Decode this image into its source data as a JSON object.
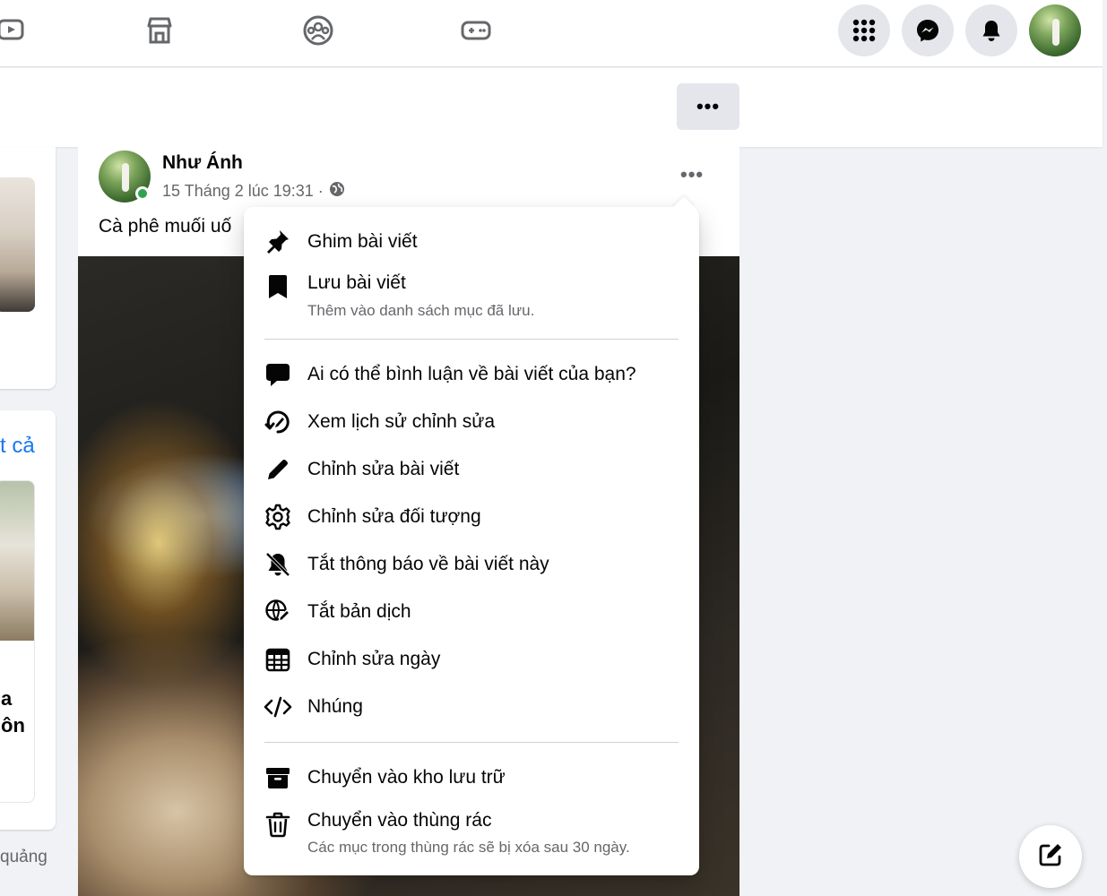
{
  "topbar": {
    "nav_icons": [
      "watch-icon",
      "marketplace-icon",
      "groups-icon",
      "gaming-icon"
    ],
    "right_buttons": [
      "menu-grid-icon",
      "messenger-icon",
      "notifications-icon"
    ]
  },
  "subbar": {
    "more_label": "•••"
  },
  "left_column": {
    "see_all": "t cả",
    "card_title_line1": "a",
    "card_title_line2": "ôn",
    "ad_label": "quảng"
  },
  "post": {
    "author": "Như Ánh",
    "timestamp": "15 Tháng 2 lúc 19:31 ·",
    "caption": "Cà phê muối uố",
    "more_label": "•••"
  },
  "menu": {
    "items": [
      {
        "icon": "pin-icon",
        "label": "Ghim bài viết"
      },
      {
        "icon": "bookmark-icon",
        "label": "Lưu bài viết",
        "sublabel": "Thêm vào danh sách mục đã lưu."
      },
      {
        "icon": "comment-icon",
        "label": "Ai có thể bình luận về bài viết của bạn?"
      },
      {
        "icon": "edit-history-icon",
        "label": "Xem lịch sử chỉnh sửa"
      },
      {
        "icon": "pencil-icon",
        "label": "Chỉnh sửa bài viết"
      },
      {
        "icon": "gear-icon",
        "label": "Chỉnh sửa đối tượng"
      },
      {
        "icon": "bell-off-icon",
        "label": "Tắt thông báo về bài viết này"
      },
      {
        "icon": "translate-off-icon",
        "label": "Tắt bản dịch"
      },
      {
        "icon": "calendar-icon",
        "label": "Chỉnh sửa ngày"
      },
      {
        "icon": "embed-icon",
        "label": "Nhúng"
      },
      {
        "icon": "archive-icon",
        "label": "Chuyển vào kho lưu trữ"
      },
      {
        "icon": "trash-icon",
        "label": "Chuyển vào thùng rác",
        "sublabel": "Các mục trong thùng rác sẽ bị xóa sau 30 ngày."
      }
    ]
  }
}
